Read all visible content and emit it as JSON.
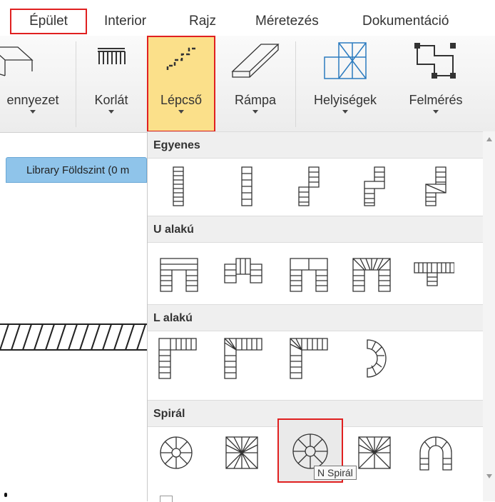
{
  "tabs": [
    {
      "label": "Épület",
      "active": true
    },
    {
      "label": "Interior"
    },
    {
      "label": "Rajz"
    },
    {
      "label": "Méretezés"
    },
    {
      "label": "Dokumentáció"
    }
  ],
  "ribbon": {
    "buttons": [
      {
        "label": "ennyezet",
        "icon": "ceiling-icon"
      },
      {
        "label": "Korlát",
        "icon": "railing-icon"
      },
      {
        "label": "Lépcső",
        "icon": "stairs-icon",
        "active": true
      },
      {
        "label": "Rámpa",
        "icon": "ramp-icon"
      },
      {
        "label": "Helyiségek",
        "icon": "rooms-icon"
      },
      {
        "label": "Felmérés",
        "icon": "survey-icon"
      }
    ]
  },
  "library_tab": "Library Földszint (0 m",
  "dropdown": {
    "sections": [
      {
        "title": "Egyenes",
        "items": [
          "straight-1",
          "straight-2",
          "straight-3",
          "straight-4",
          "straight-5"
        ]
      },
      {
        "title": "U alakú",
        "items": [
          "u-1",
          "u-2",
          "u-3",
          "u-4",
          "u-5"
        ]
      },
      {
        "title": "L alakú",
        "items": [
          "l-1",
          "l-2",
          "l-3",
          "l-4"
        ]
      },
      {
        "title": "Spirál",
        "items": [
          "spiral-1",
          "spiral-2",
          "spiral-3",
          "spiral-4",
          "spiral-5"
        ],
        "selected_index": 2
      }
    ]
  },
  "tooltip": "N Spirál",
  "colors": {
    "highlight": "#e02020",
    "active_fill": "#fbe08a",
    "library_tab": "#8fc4ea"
  }
}
